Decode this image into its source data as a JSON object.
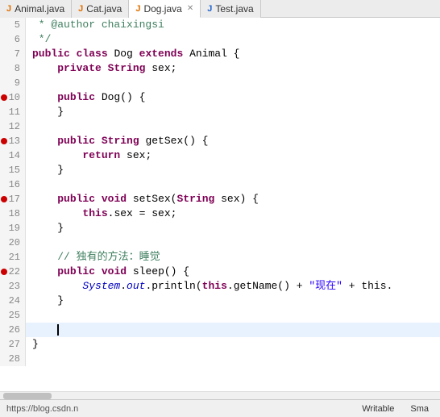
{
  "tabs": [
    {
      "label": "Animal.java",
      "icon": "java-orange",
      "active": false,
      "closeable": false
    },
    {
      "label": "Cat.java",
      "icon": "java-orange",
      "active": false,
      "closeable": false
    },
    {
      "label": "Dog.java",
      "icon": "java-orange",
      "active": true,
      "closeable": true
    },
    {
      "label": "Test.java",
      "icon": "java-blue",
      "active": false,
      "closeable": false
    }
  ],
  "lines": [
    {
      "num": "5",
      "bp": false,
      "content": " * @author chaixingsi"
    },
    {
      "num": "6",
      "bp": false,
      "content": " */"
    },
    {
      "num": "7",
      "bp": false,
      "content": "public class Dog extends Animal {"
    },
    {
      "num": "8",
      "bp": false,
      "content": "    private String sex;"
    },
    {
      "num": "9",
      "bp": false,
      "content": ""
    },
    {
      "num": "10",
      "bp": true,
      "content": "    public Dog() {"
    },
    {
      "num": "11",
      "bp": false,
      "content": "    }"
    },
    {
      "num": "12",
      "bp": false,
      "content": ""
    },
    {
      "num": "13",
      "bp": true,
      "content": "    public String getSex() {"
    },
    {
      "num": "14",
      "bp": false,
      "content": "        return sex;"
    },
    {
      "num": "15",
      "bp": false,
      "content": "    }"
    },
    {
      "num": "16",
      "bp": false,
      "content": ""
    },
    {
      "num": "17",
      "bp": true,
      "content": "    public void setSex(String sex) {"
    },
    {
      "num": "18",
      "bp": false,
      "content": "        this.sex = sex;"
    },
    {
      "num": "19",
      "bp": false,
      "content": "    }"
    },
    {
      "num": "20",
      "bp": false,
      "content": ""
    },
    {
      "num": "21",
      "bp": false,
      "content": "    // 独有的方法：睡觉"
    },
    {
      "num": "22",
      "bp": true,
      "content": "    public void sleep() {"
    },
    {
      "num": "23",
      "bp": false,
      "content": "        System.out.println(this.getName() + \"现在\" + this."
    },
    {
      "num": "24",
      "bp": false,
      "content": "    }"
    },
    {
      "num": "25",
      "bp": false,
      "content": ""
    },
    {
      "num": "26",
      "bp": false,
      "content": "",
      "cursor": true
    },
    {
      "num": "27",
      "bp": false,
      "content": "}"
    },
    {
      "num": "28",
      "bp": false,
      "content": ""
    }
  ],
  "status": {
    "url": "https://blog.csdn.n",
    "writable": "Writable",
    "mode": "Sma"
  }
}
